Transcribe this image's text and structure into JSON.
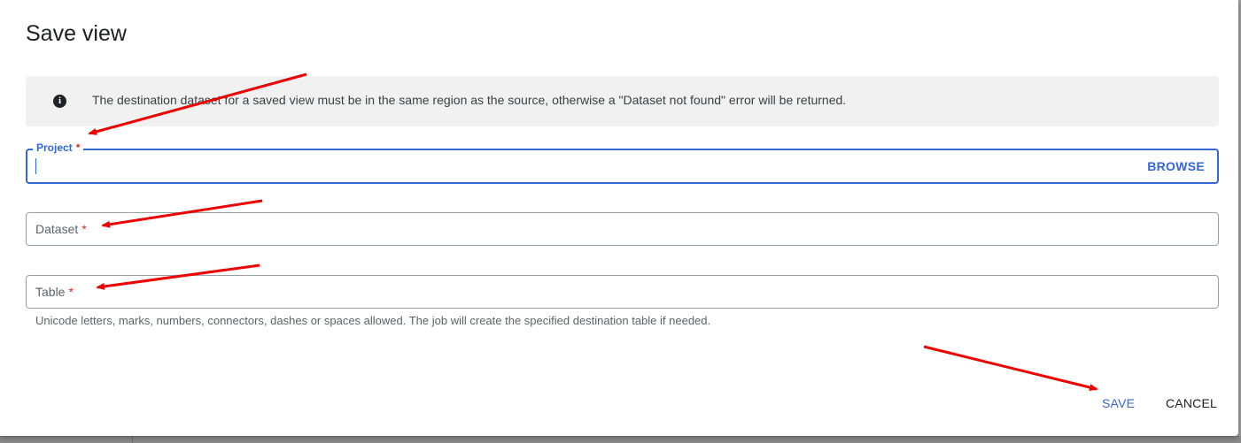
{
  "dialog": {
    "title": "Save view",
    "info": {
      "icon": "info-icon",
      "icon_glyph": "i",
      "text": "The destination dataset for a saved view must be in the same region as the source, otherwise a \"Dataset not found\" error will be returned."
    },
    "fields": {
      "project": {
        "label": "Project",
        "required_mark": "*",
        "value": "",
        "action_label": "BROWSE"
      },
      "dataset": {
        "label": "Dataset",
        "required_mark": "*",
        "value": ""
      },
      "table": {
        "label": "Table",
        "required_mark": "*",
        "value": "",
        "hint": "Unicode letters, marks, numbers, connectors, dashes or spaces allowed. The job will create the specified destination table if needed."
      }
    },
    "actions": {
      "save_label": "SAVE",
      "cancel_label": "CANCEL"
    }
  },
  "colors": {
    "accent": "#3367d6",
    "required": "#d93025",
    "annotation_arrow": "#ee0000",
    "info_background": "#f1f1f1"
  }
}
